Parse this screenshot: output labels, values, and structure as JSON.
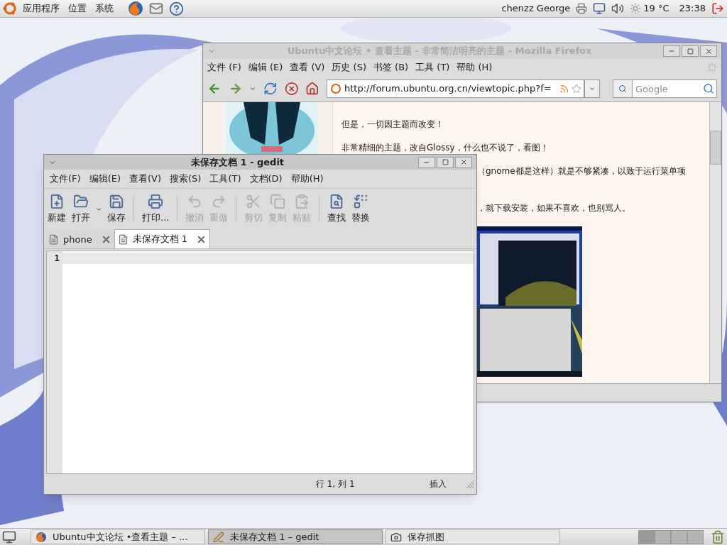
{
  "top_panel": {
    "menus": [
      "应用程序",
      "位置",
      "系统"
    ],
    "user": "chenzz George",
    "weather": "19 °C",
    "clock": "23:38"
  },
  "firefox": {
    "title": "Ubuntu中文论坛 • 查看主题 - 非常简洁明亮的主题 - Mozilla Firefox",
    "active": false,
    "menus": [
      "文件 (F)",
      "编辑 (E)",
      "查看 (V)",
      "历史 (S)",
      "书签 (B)",
      "工具 (T)",
      "帮助 (H)"
    ],
    "url": "http://forum.ubuntu.org.cn/viewtopic.php?f=",
    "search_placeholder": "Google",
    "post_lines": [
      {
        "kind": "full",
        "text": "但是，一切因主题而改变！"
      },
      {
        "kind": "full",
        "text": "非常精细的主题，改自Glossy，什么也不说了，看图！"
      },
      {
        "kind": "clipped",
        "text": "（gnome都是这样）就是不够紧凑，以致于运行菜单项"
      },
      {
        "kind": "clipped",
        "text": "，就下载安装，如果不喜欢，也别骂人。"
      }
    ]
  },
  "gedit": {
    "title": "未保存文档 1 - gedit",
    "active": true,
    "menus": [
      "文件(F)",
      "编辑(E)",
      "查看(V)",
      "搜索(S)",
      "工具(T)",
      "文档(D)",
      "帮助(H)"
    ],
    "toolbar": [
      {
        "label": "新建",
        "disabled": false
      },
      {
        "label": "打开",
        "disabled": false
      },
      {
        "label": "保存",
        "disabled": false
      },
      {
        "label": "打印...",
        "disabled": false
      },
      {
        "label": "撤消",
        "disabled": true
      },
      {
        "label": "重做",
        "disabled": true
      },
      {
        "label": "剪切",
        "disabled": true
      },
      {
        "label": "复制",
        "disabled": true
      },
      {
        "label": "粘贴",
        "disabled": true
      },
      {
        "label": "查找",
        "disabled": false
      },
      {
        "label": "替换",
        "disabled": false
      }
    ],
    "tabs": [
      {
        "label": "phone",
        "selected": false
      },
      {
        "label": "未保存文档 1",
        "selected": true
      }
    ],
    "line_numbers": [
      "1"
    ],
    "status_position": "行 1, 列 1",
    "status_mode": "插入"
  },
  "taskbar": [
    {
      "label": "Ubuntu中文论坛 •查看主题 – ...",
      "selected": false
    },
    {
      "label": "未保存文档 1 – gedit",
      "selected": true
    },
    {
      "label": "保存抓图",
      "selected": false
    }
  ]
}
